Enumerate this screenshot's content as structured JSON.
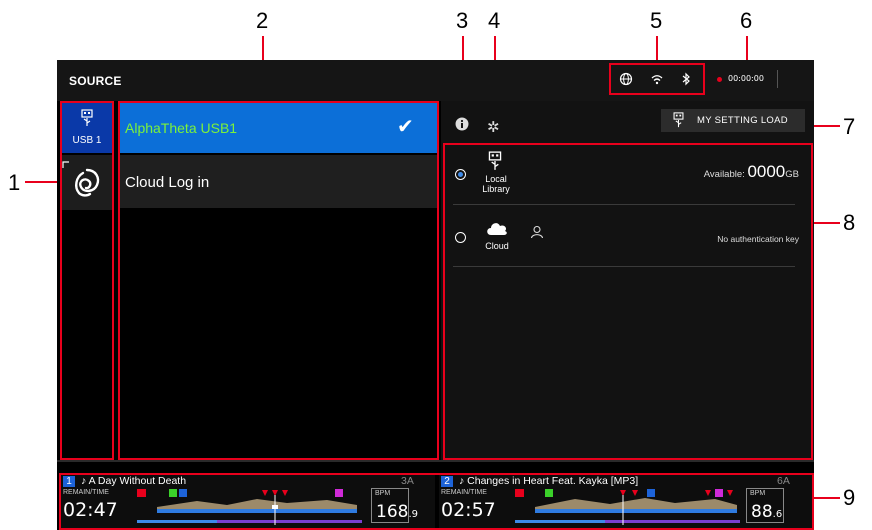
{
  "callouts": [
    "1",
    "2",
    "3",
    "4",
    "5",
    "6",
    "7",
    "8",
    "9"
  ],
  "header": {
    "title": "SOURCE",
    "rec_time": "00:00:00"
  },
  "sidebar": {
    "usb_tab_label": "USB 1"
  },
  "sources": [
    {
      "label": "AlphaTheta USB1",
      "selected": true
    },
    {
      "label": "Cloud Log in",
      "selected": false
    }
  ],
  "settings_button": {
    "label": "MY SETTING LOAD"
  },
  "options": {
    "local": {
      "label_line1": "Local",
      "label_line2": "Library",
      "available_prefix": "Available:",
      "available_value": "0000",
      "available_unit": "GB"
    },
    "cloud": {
      "label": "Cloud",
      "status": "No authentication key"
    }
  },
  "decks": [
    {
      "number": "1",
      "track": "A Day Without Death",
      "key": "3A",
      "remain_label": "REMAIN/TIME",
      "time": "02:47",
      "bpm_label": "BPM",
      "bpm_int": "168",
      "bpm_dec": ".9"
    },
    {
      "number": "2",
      "track": "Changes in Heart Feat. Kayka [MP3]",
      "key": "6A",
      "remain_label": "REMAIN/TIME",
      "time": "02:57",
      "bpm_label": "BPM",
      "bpm_int": "88",
      "bpm_dec": ".6"
    }
  ],
  "colors": {
    "accent_red": "#e8001c",
    "selection_blue": "#0c6fd8",
    "usb_tab_blue": "#0a39a8",
    "selected_text_green": "#7cf23a"
  }
}
